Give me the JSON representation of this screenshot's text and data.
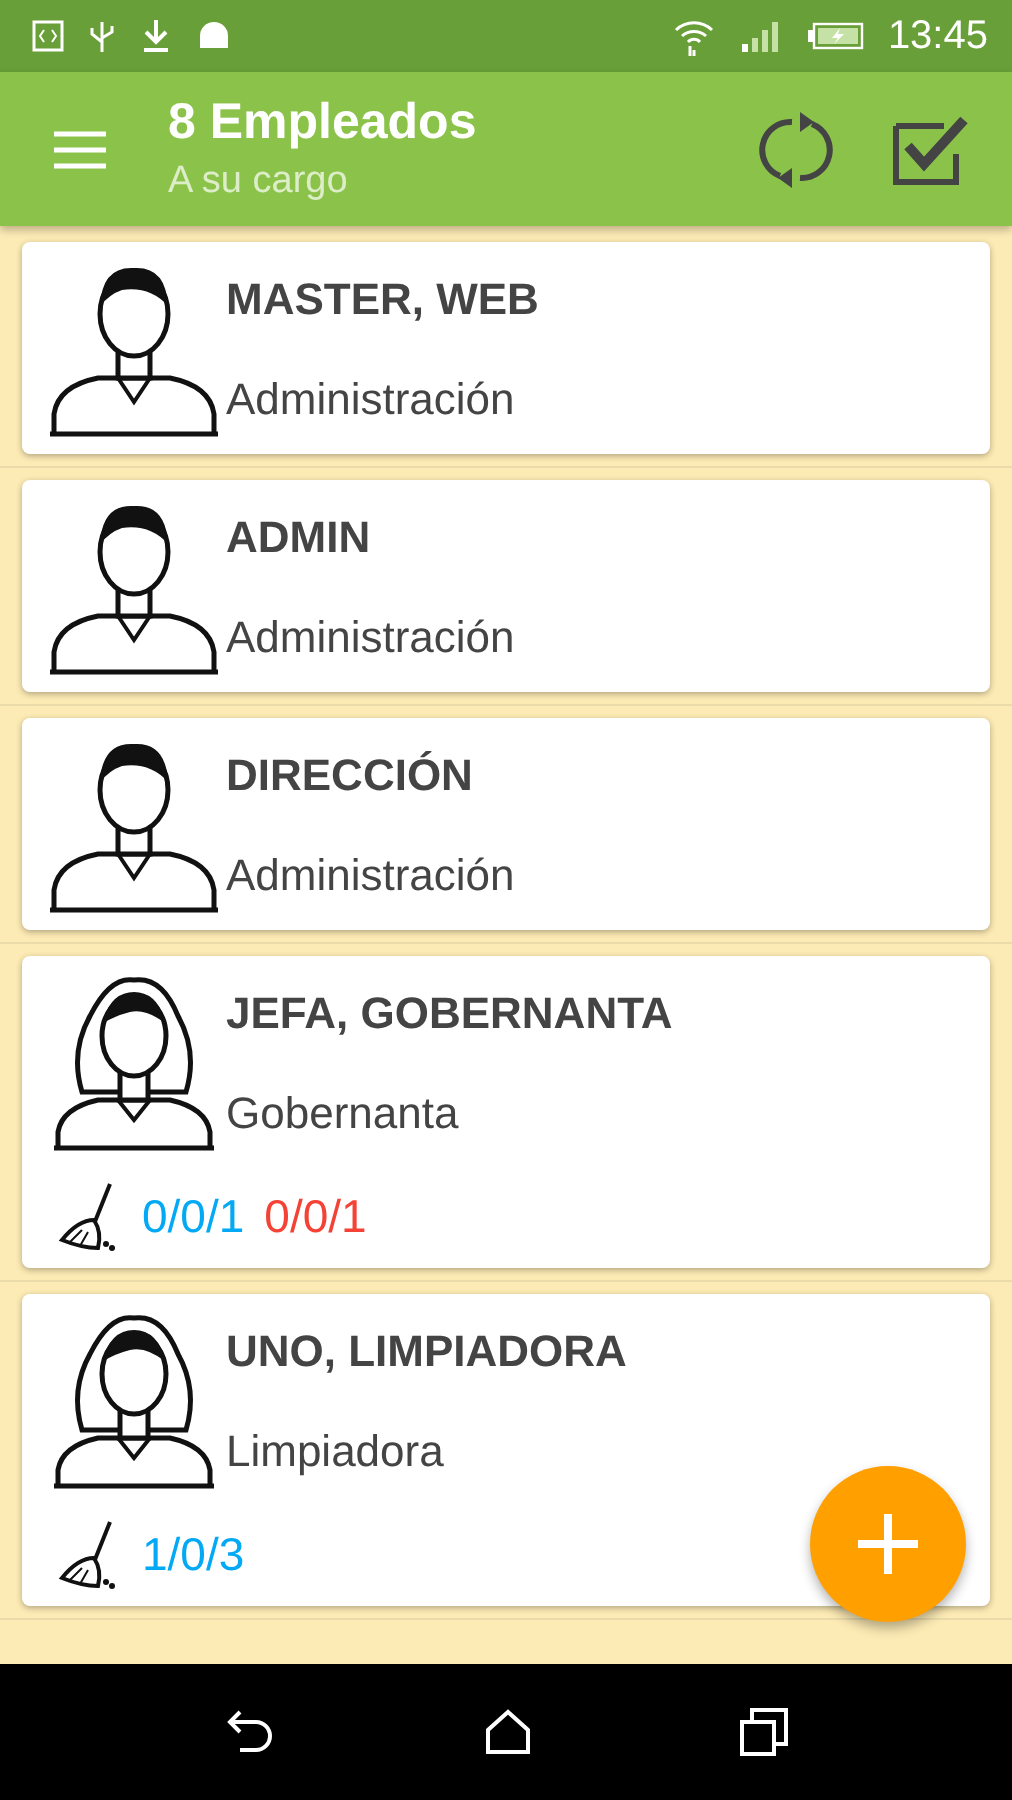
{
  "status_bar": {
    "time": "13:45"
  },
  "app_bar": {
    "title": "8 Empleados",
    "subtitle": "A su cargo"
  },
  "employees": [
    {
      "name": "MASTER, WEB",
      "department": "Administración",
      "kind": "male"
    },
    {
      "name": "ADMIN",
      "department": "Administración",
      "kind": "male"
    },
    {
      "name": "DIRECCIÓN",
      "department": "Administración",
      "kind": "male"
    },
    {
      "name": "JEFA, GOBERNANTA",
      "department": "Gobernanta",
      "kind": "female",
      "stats": [
        {
          "text": "0/0/1",
          "color": "#03a9f4"
        },
        {
          "text": "0/0/1",
          "color": "#f44336"
        }
      ]
    },
    {
      "name": "UNO, LIMPIADORA",
      "department": "Limpiadora",
      "kind": "female",
      "stats": [
        {
          "text": "1/0/3",
          "color": "#03a9f4"
        }
      ]
    }
  ]
}
